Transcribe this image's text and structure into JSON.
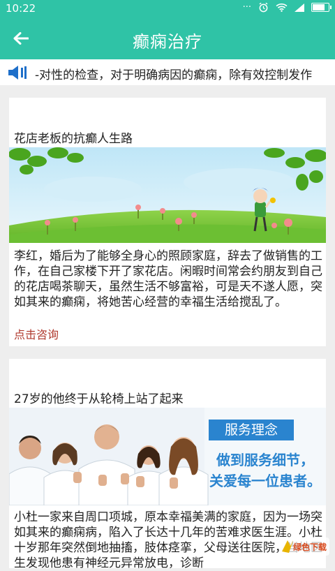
{
  "status_bar": {
    "time": "10:22",
    "battery_level": 0.85
  },
  "app_bar": {
    "title": "癫痫治疗"
  },
  "notice": {
    "text": "-对性的检查，对于明确病因的癫痫，除有效控制发作"
  },
  "cards": [
    {
      "title": "花店老板的抗癫人生路",
      "description": "李红，婚后为了能够全身心的照顾家庭，辞去了做销售的工作，在自己家楼下开了家花店。闲暇时间常会约朋友到自己的花店喝茶聊天，虽然生活不够富裕，可是天不遂人愿，突如其来的癫痫，将她苦心经营的幸福生活给搅乱了。",
      "consult_label": "点击咨询"
    },
    {
      "title": "27岁的他终于从轮椅上站了起来",
      "banner": {
        "heading": "服务理念",
        "line1": "做到服务细节，",
        "line2": "关爱每一位患者。"
      },
      "description": "小杜一家来自周口项城，原本幸福美满的家庭，因为一场突如其来的癫痫病，陷入了长达十几年的苦难求医生涯。小杜十岁那年突然倒地抽搐，肢体痉挛，父母送往医院，当地医生发现他患有神经元异常放电，诊断"
    }
  ],
  "watermark": {
    "text": "绿色下载"
  },
  "colors": {
    "primary": "#2fc3a6",
    "link": "#b03a2e"
  }
}
